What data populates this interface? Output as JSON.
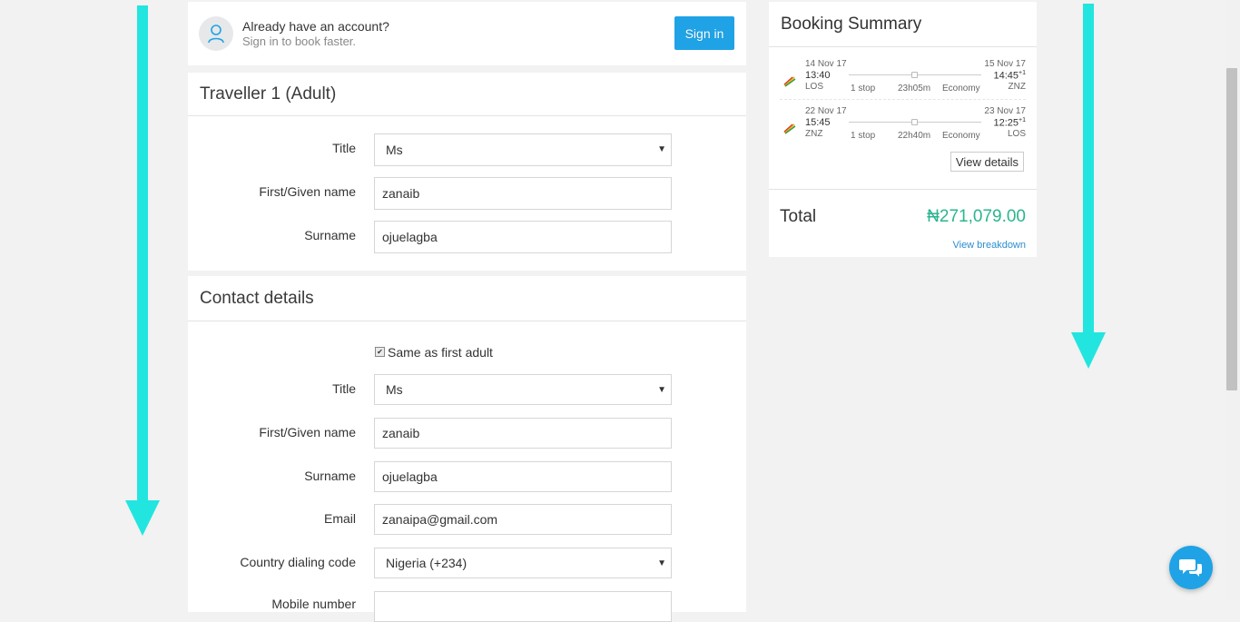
{
  "signin": {
    "title": "Already have an account?",
    "subtitle": "Sign in to book faster.",
    "button": "Sign in"
  },
  "traveller": {
    "heading": "Traveller 1 (Adult)",
    "fields": {
      "title_label": "Title",
      "title_value": "Ms",
      "first_label": "First/Given name",
      "first_value": "zanaib",
      "surname_label": "Surname",
      "surname_value": "ojuelagba"
    }
  },
  "contact": {
    "heading": "Contact details",
    "same_label": "Same as first adult",
    "same_checked": true,
    "fields": {
      "title_label": "Title",
      "title_value": "Ms",
      "first_label": "First/Given name",
      "first_value": "zanaib",
      "surname_label": "Surname",
      "surname_value": "ojuelagba",
      "email_label": "Email",
      "email_value": "zanaipa@gmail.com",
      "dial_label": "Country dialing code",
      "dial_value": "Nigeria (+234)",
      "mobile_label": "Mobile number"
    }
  },
  "summary": {
    "title": "Booking Summary",
    "legs": [
      {
        "dep_date": "14 Nov 17",
        "dep_time": "13:40",
        "dep_airport": "LOS",
        "arr_date": "15 Nov 17",
        "arr_time": "14:45",
        "arr_plus": "+1",
        "arr_airport": "ZNZ",
        "stops": "1 stop",
        "duration": "23h05m",
        "cabin": "Economy"
      },
      {
        "dep_date": "22 Nov 17",
        "dep_time": "15:45",
        "dep_airport": "ZNZ",
        "arr_date": "23 Nov 17",
        "arr_time": "12:25",
        "arr_plus": "+1",
        "arr_airport": "LOS",
        "stops": "1 stop",
        "duration": "22h40m",
        "cabin": "Economy"
      }
    ],
    "view_details": "View details",
    "total_label": "Total",
    "total_value": "₦271,079.00",
    "breakdown": "View breakdown"
  },
  "colors": {
    "accent": "#1fa3e6",
    "price": "#2bb58f",
    "arrow": "#22e5e0"
  }
}
